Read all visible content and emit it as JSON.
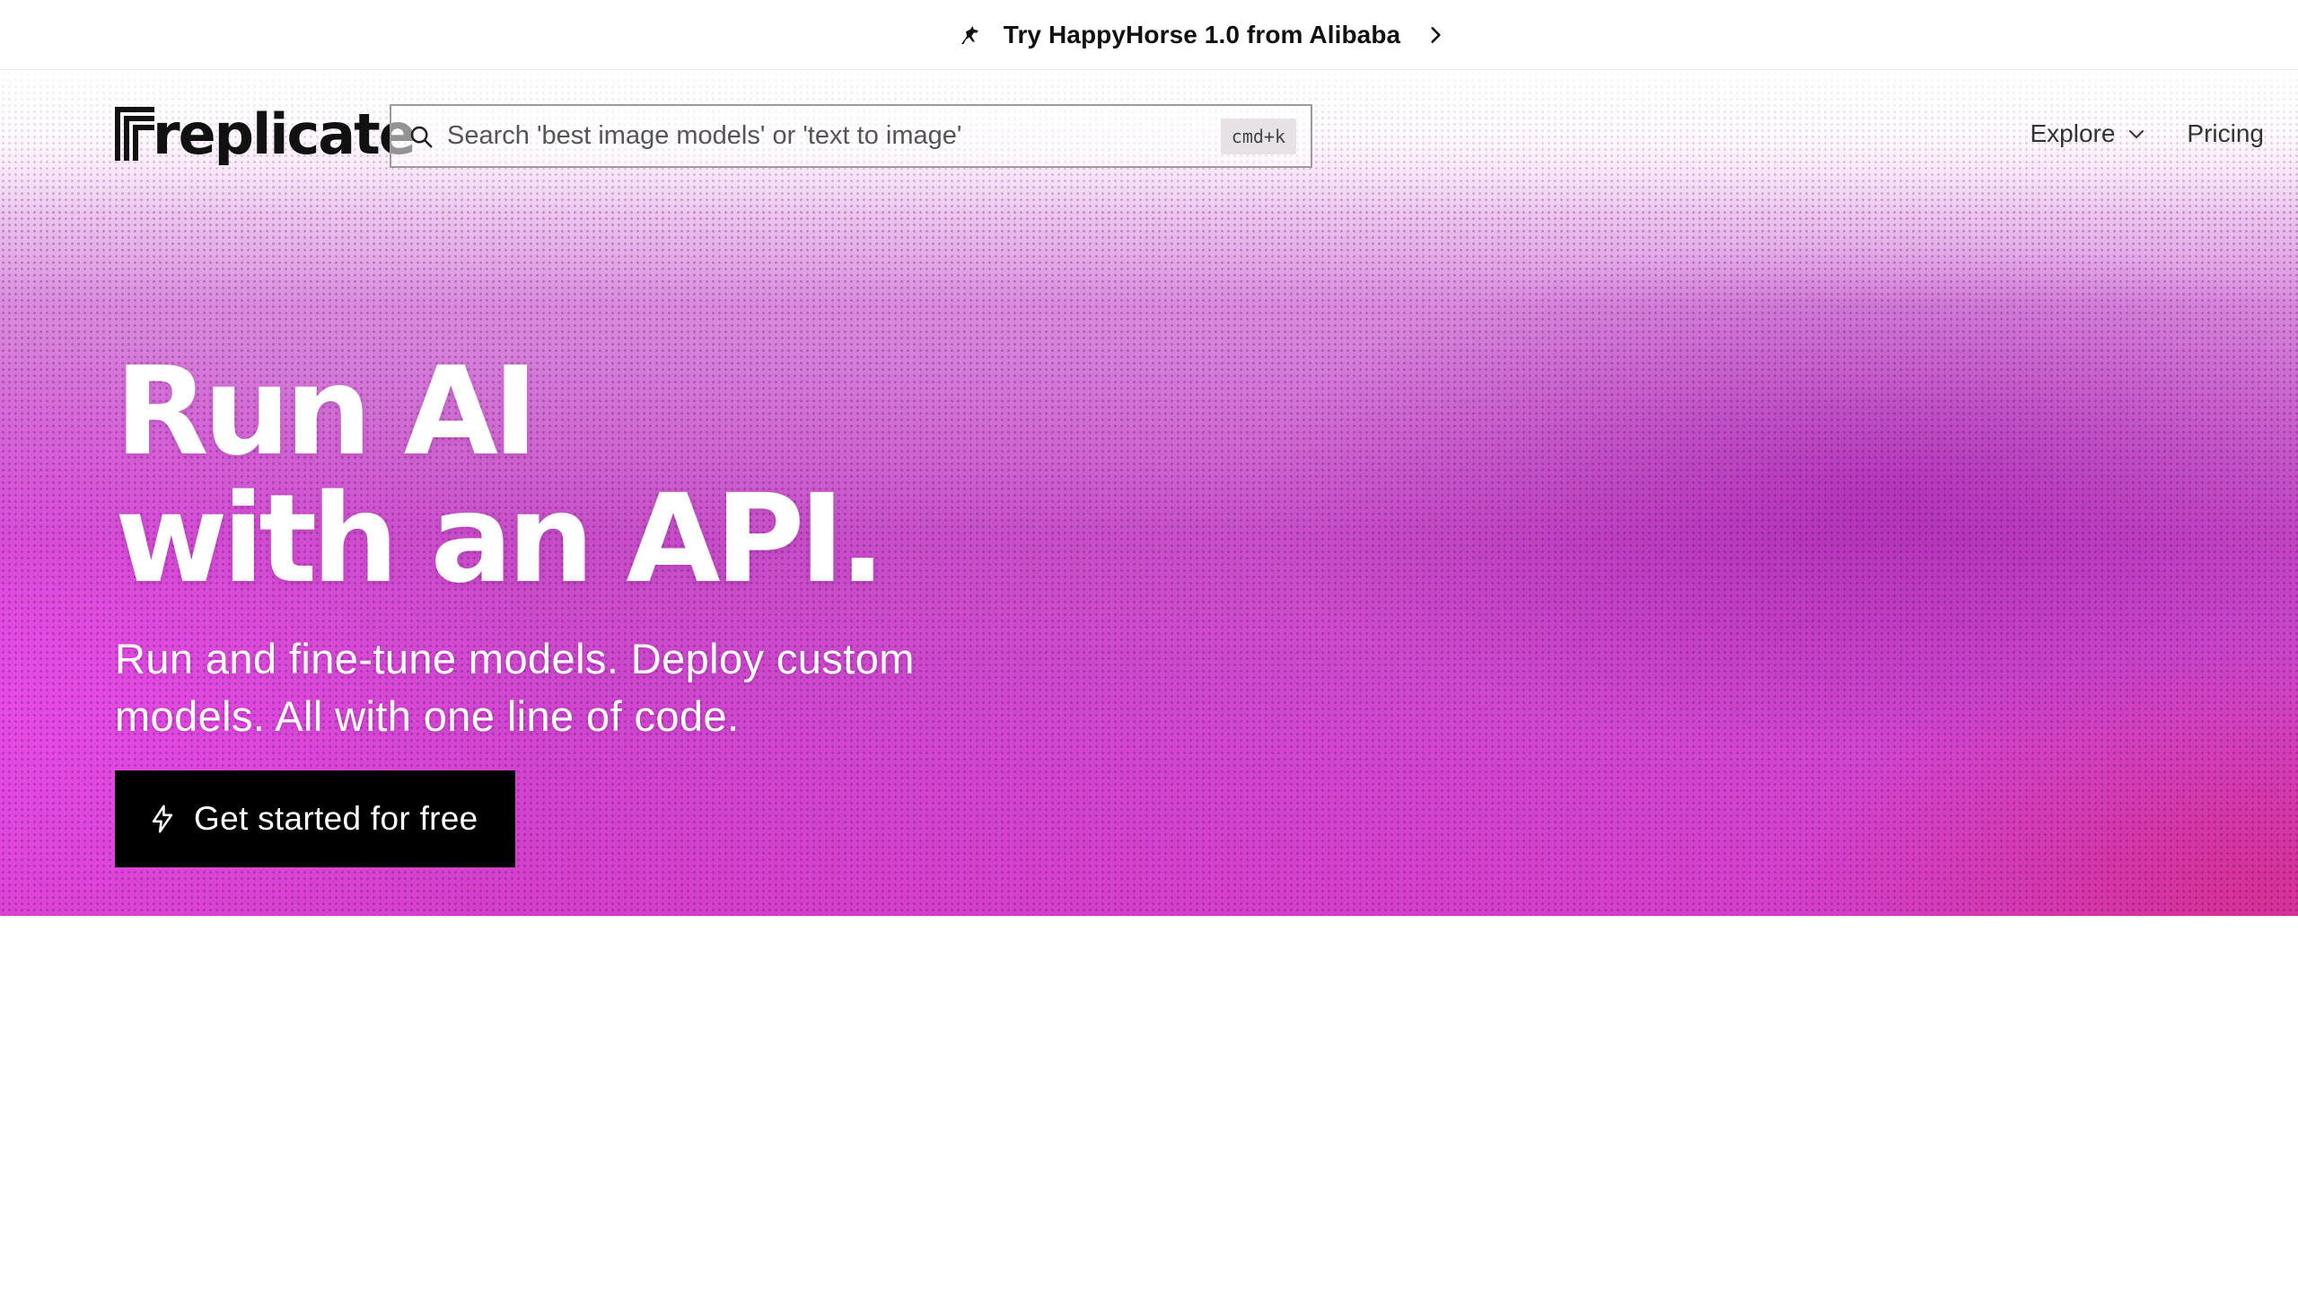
{
  "announcement": {
    "text": "Try HappyHorse 1.0 from Alibaba",
    "icon": "horse-icon",
    "arrow_icon": "chevron-right-icon"
  },
  "header": {
    "logo_text": "replicate",
    "search": {
      "placeholder": "Search 'best image models' or 'text to image'",
      "value": "",
      "shortcut": "cmd+k"
    },
    "nav": [
      {
        "label": "Explore",
        "icon": "chevron-down-icon"
      },
      {
        "label": "Pricing"
      }
    ]
  },
  "hero": {
    "headline_line1": "Run AI",
    "headline_line2": "with an API.",
    "subheadline": "Run and fine-tune models. Deploy custom models. All with one line of code.",
    "cta_label": "Get started for free",
    "cta_icon": "bolt-icon"
  },
  "colors": {
    "hero_pink": "#d43fca",
    "hero_purple": "#b02abb",
    "cta_background": "#000000",
    "text_dark": "#111111"
  }
}
